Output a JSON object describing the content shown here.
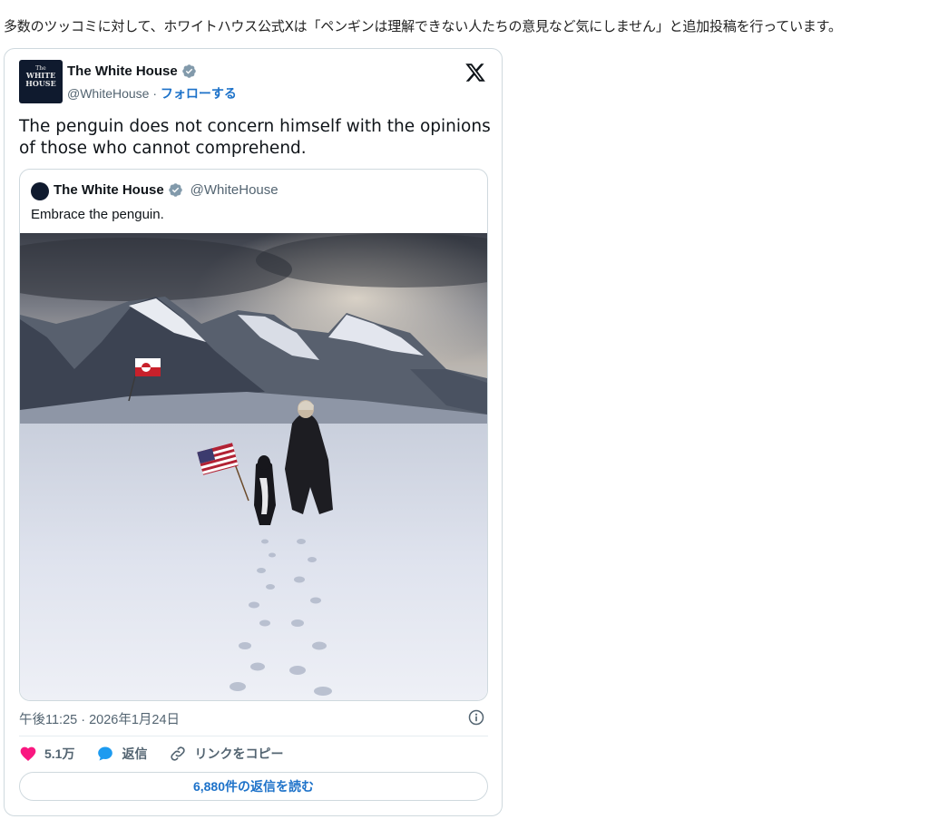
{
  "caption": "多数のツッコミに対して、ホワイトハウス公式Xは「ペンギンは理解できない人たちの意見など気にしません」と追加投稿を行っています。",
  "tweet": {
    "avatar_lines": [
      "The",
      "WHITE",
      "HOUSE"
    ],
    "author_name": "The White House",
    "handle": "@WhiteHouse",
    "separator": " · ",
    "follow_label": "フォローする",
    "text": "The penguin does not concern himself with the opinions of those who cannot comprehend.",
    "quote": {
      "author_name": "The White House",
      "handle": "@WhiteHouse",
      "text": "Embrace the penguin."
    },
    "timestamp": "午後11:25 · 2026年1月24日",
    "likes": "5.1万",
    "reply_label": "返信",
    "copy_link_label": "リンクをコピー",
    "read_replies_label": "6,880件の返信を読む"
  },
  "colors": {
    "verified": "#829aab",
    "link": "#1d72c9",
    "like": "#f91880",
    "reply": "#1d9bf0",
    "border": "#cfd9de"
  },
  "icons": [
    "verified-badge-icon",
    "x-logo-icon",
    "info-icon",
    "heart-icon",
    "reply-bubble-icon",
    "link-icon"
  ]
}
